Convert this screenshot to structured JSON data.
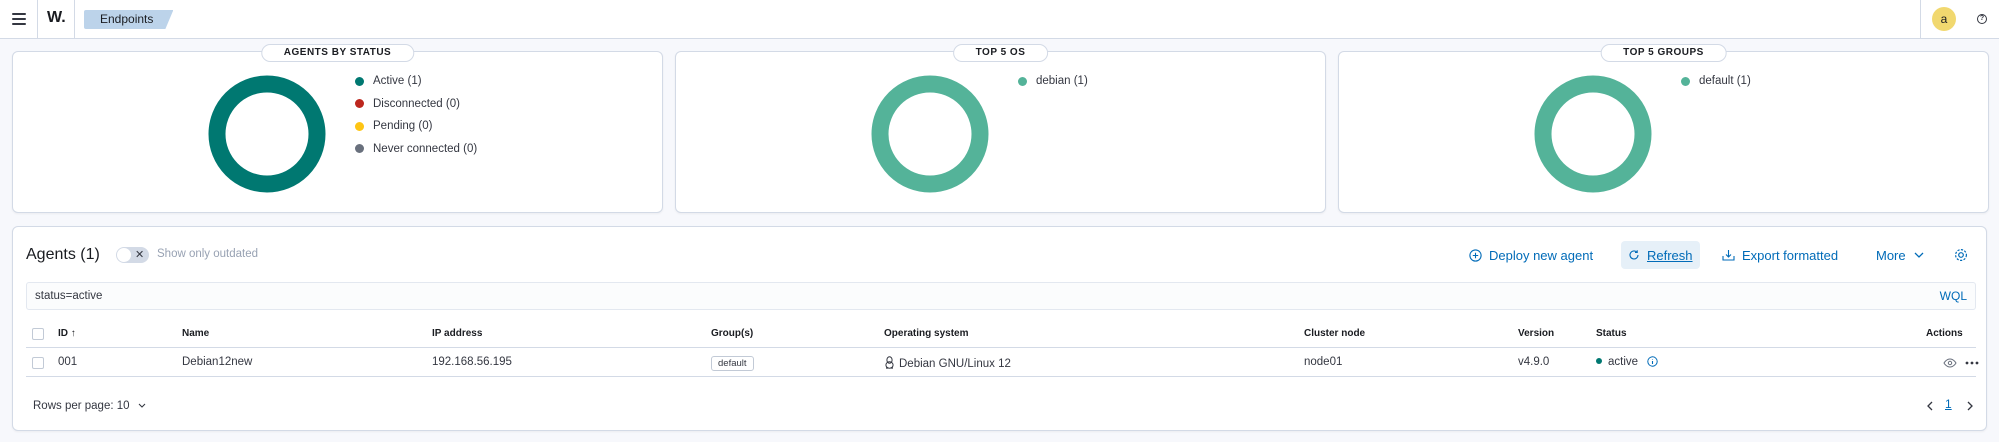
{
  "header": {
    "logo": "W.",
    "breadcrumb": "Endpoints",
    "avatar": "a",
    "help_glyph": "?"
  },
  "status_card": {
    "title": "AGENTS BY STATUS",
    "legend": [
      {
        "label": "Active (1)",
        "color": "#007871"
      },
      {
        "label": "Disconnected (0)",
        "color": "#bd271e"
      },
      {
        "label": "Pending (0)",
        "color": "#fec514"
      },
      {
        "label": "Never connected (0)",
        "color": "#69707d"
      }
    ],
    "donut_color": "#007871"
  },
  "os_card": {
    "title": "TOP 5 OS",
    "legend": [
      {
        "label": "debian (1)",
        "color": "#54b399"
      }
    ],
    "donut_color": "#54b399"
  },
  "groups_card": {
    "title": "TOP 5 GROUPS",
    "legend": [
      {
        "label": "default (1)",
        "color": "#54b399"
      }
    ],
    "donut_color": "#54b399"
  },
  "agents": {
    "title": "Agents (1)",
    "toggle_label": "Show only outdated",
    "actions": {
      "deploy": "Deploy new agent",
      "refresh": "Refresh",
      "export": "Export formatted",
      "more": "More"
    },
    "search_value": "status=active",
    "wql": "WQL",
    "columns": {
      "id": "ID",
      "name": "Name",
      "ip": "IP address",
      "groups": "Group(s)",
      "os": "Operating system",
      "cluster": "Cluster node",
      "version": "Version",
      "status": "Status",
      "actions": "Actions"
    },
    "rows": [
      {
        "id": "001",
        "name": "Debian12new",
        "ip": "192.168.56.195",
        "group": "default",
        "os": "Debian GNU/Linux 12",
        "cluster": "node01",
        "version": "v4.9.0",
        "status": "active"
      }
    ],
    "rows_per_page": "Rows per page: 10",
    "current_page": "1"
  }
}
